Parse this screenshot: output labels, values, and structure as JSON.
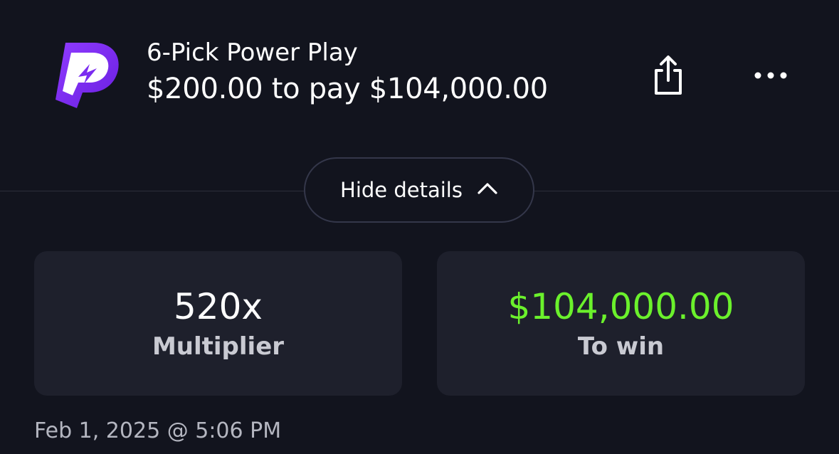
{
  "header": {
    "logo_icon": "prizepicks-logo-icon",
    "title": "6-Pick Power Play",
    "subtitle": "$200.00 to pay $104,000.00",
    "share_icon": "share-icon",
    "more_icon": "more-options-icon"
  },
  "details_toggle": {
    "label": "Hide details",
    "icon": "chevron-up-icon"
  },
  "stats": {
    "multiplier": {
      "value": "520x",
      "label": "Multiplier"
    },
    "to_win": {
      "value": "$104,000.00",
      "label": "To win"
    }
  },
  "timestamp": "Feb 1, 2025 @ 5:06 PM",
  "colors": {
    "background": "#12141e",
    "card": "#1e202c",
    "accent_green": "#6bf12c",
    "brand_purple": "#7b2cf0"
  }
}
